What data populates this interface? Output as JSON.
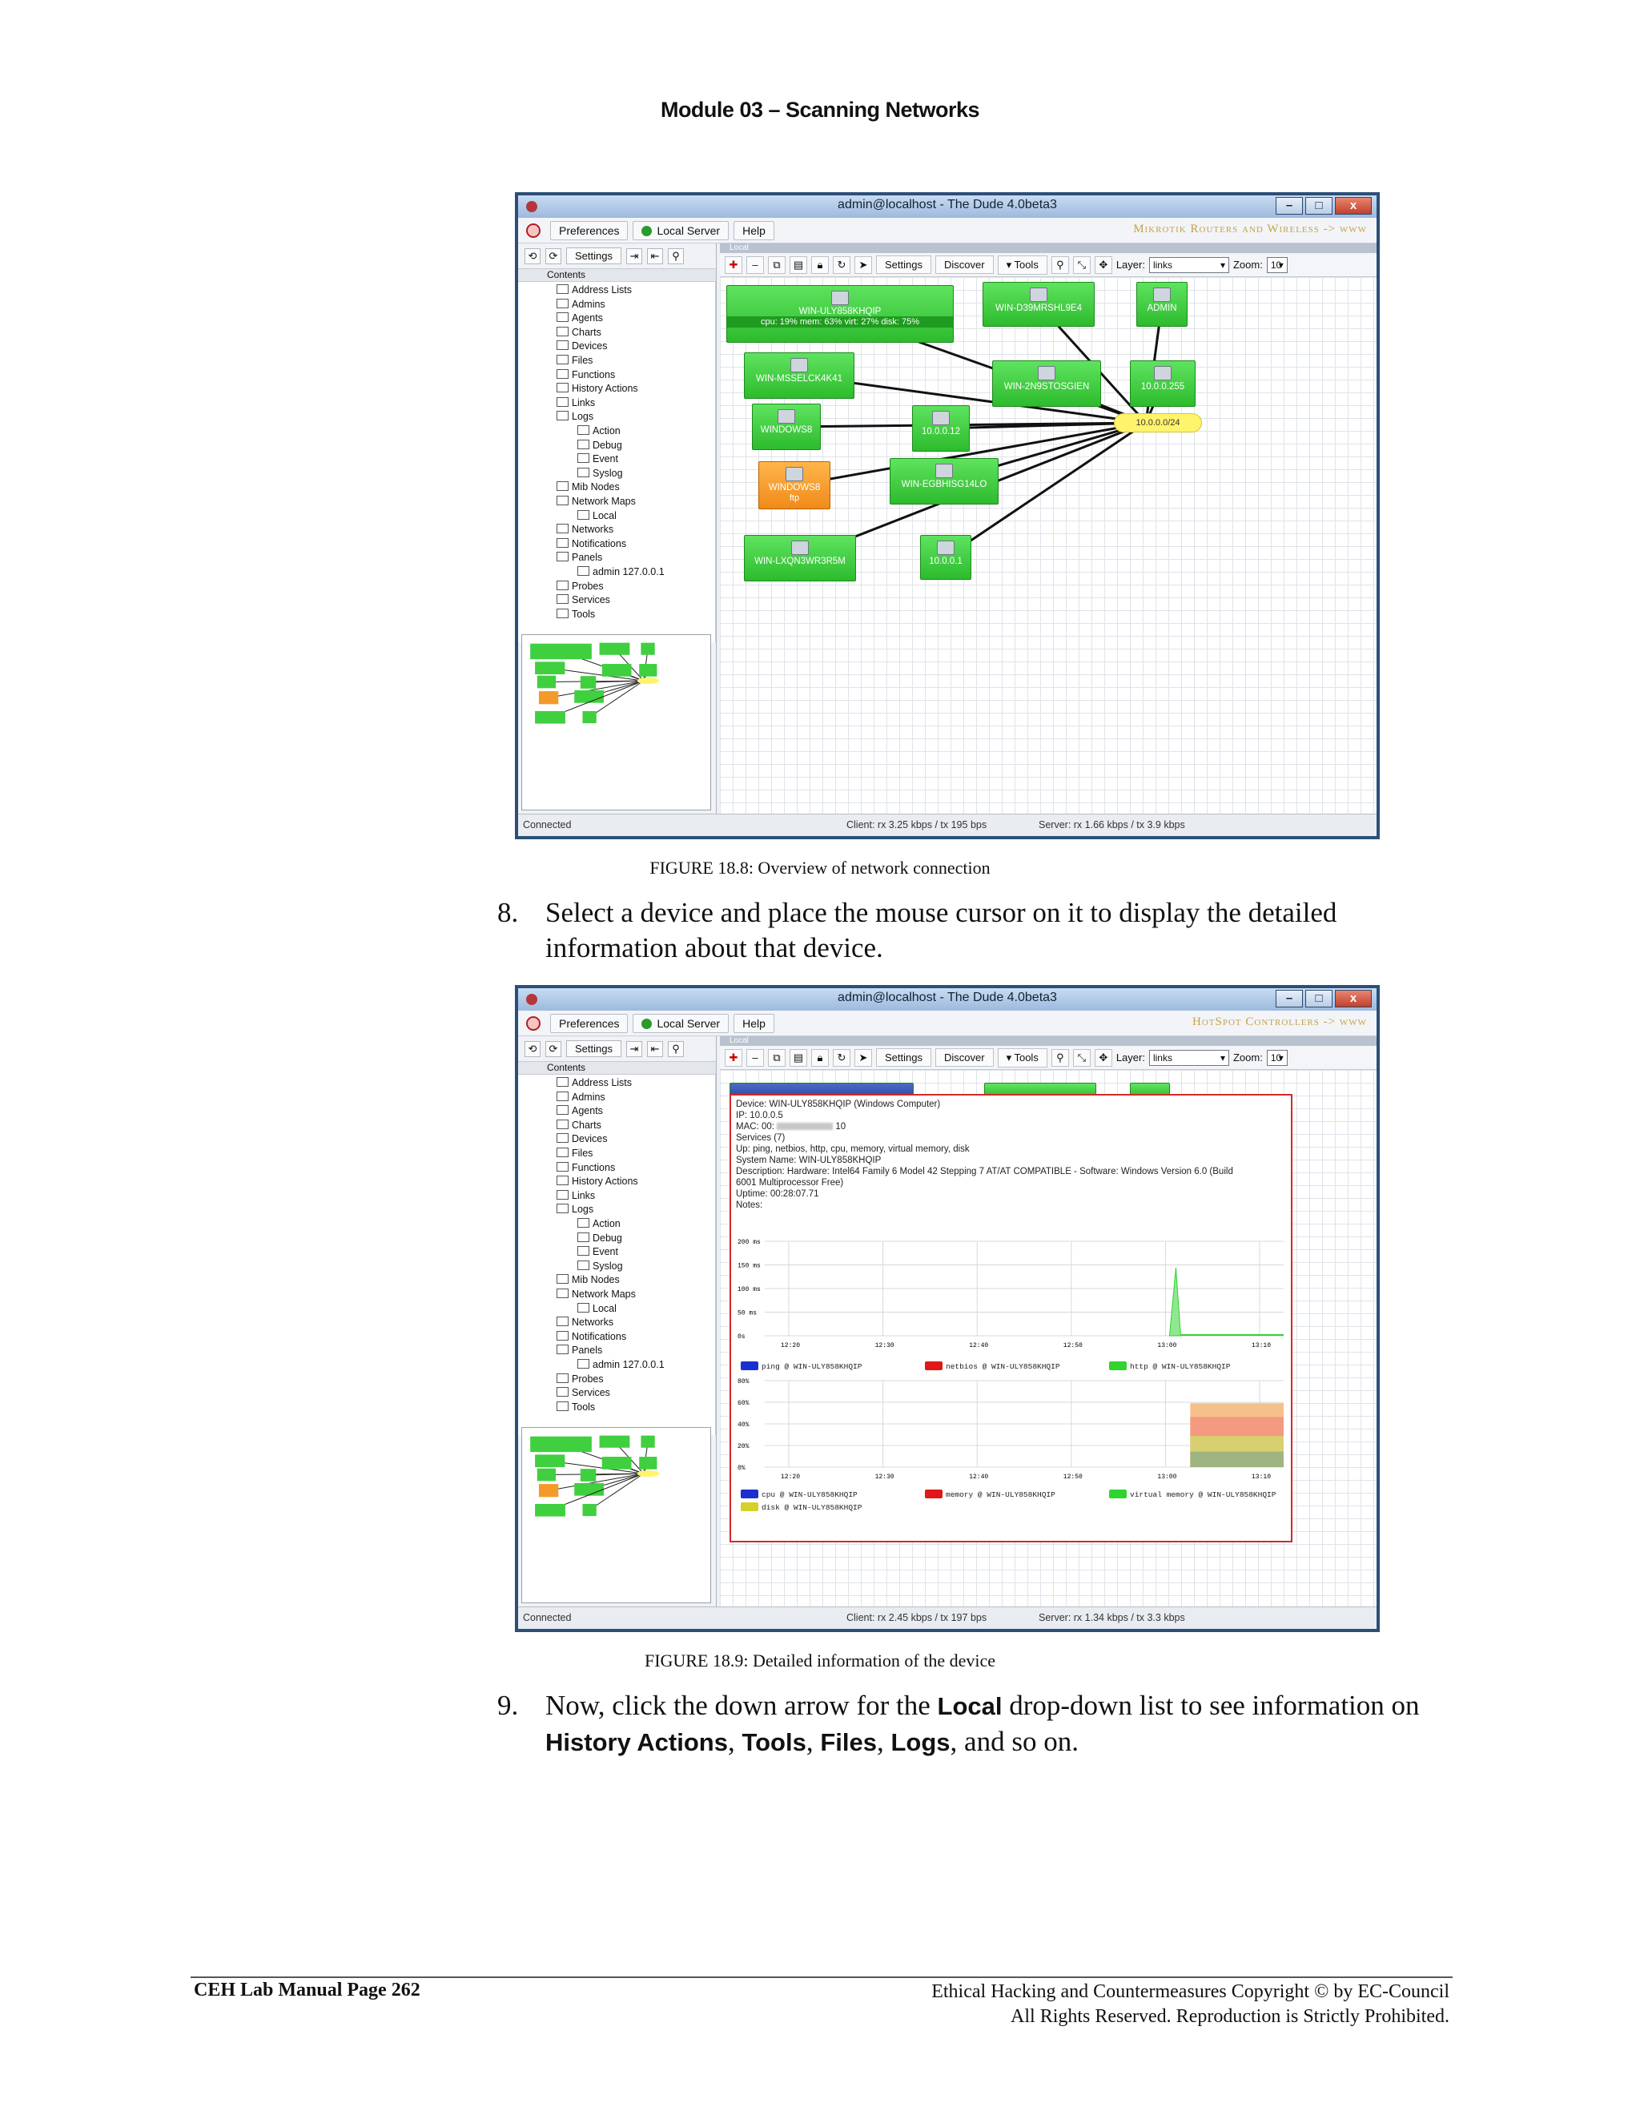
{
  "header": {
    "module_title": "Module 03 – Scanning Networks"
  },
  "window": {
    "title": "admin@localhost - The Dude 4.0beta3",
    "menu": [
      "Preferences",
      "Local Server",
      "Help"
    ],
    "brand_1": "Mikrotik Routers and Wireless -> www",
    "brand_2": "HotSpot Controllers -> www",
    "settings_label": "Settings",
    "contents_label": "Contents",
    "tab_label": "Local",
    "toolbar": {
      "settings": "Settings",
      "discover": "Discover",
      "tools": "▾ Tools",
      "layer_label": "Layer:",
      "layer_value": "links",
      "zoom_label": "Zoom:",
      "zoom_value": "10"
    },
    "tree": [
      {
        "label": "Address Lists",
        "indent": 1
      },
      {
        "label": "Admins",
        "indent": 1
      },
      {
        "label": "Agents",
        "indent": 1
      },
      {
        "label": "Charts",
        "indent": 1
      },
      {
        "label": "Devices",
        "indent": 1
      },
      {
        "label": "Files",
        "indent": 1
      },
      {
        "label": "Functions",
        "indent": 1
      },
      {
        "label": "History Actions",
        "indent": 1
      },
      {
        "label": "Links",
        "indent": 1
      },
      {
        "label": "Logs",
        "indent": 1
      },
      {
        "label": "Action",
        "indent": 2
      },
      {
        "label": "Debug",
        "indent": 2
      },
      {
        "label": "Event",
        "indent": 2
      },
      {
        "label": "Syslog",
        "indent": 2
      },
      {
        "label": "Mib Nodes",
        "indent": 1
      },
      {
        "label": "Network Maps",
        "indent": 1
      },
      {
        "label": "Local",
        "indent": 2
      },
      {
        "label": "Networks",
        "indent": 1
      },
      {
        "label": "Notifications",
        "indent": 1
      },
      {
        "label": "Panels",
        "indent": 1
      },
      {
        "label": "admin 127.0.0.1",
        "indent": 2
      },
      {
        "label": "Probes",
        "indent": 1
      },
      {
        "label": "Services",
        "indent": 1
      },
      {
        "label": "Tools",
        "indent": 1
      }
    ],
    "status_1": {
      "left": "Connected",
      "client": "Client: rx 3.25 kbps / tx 195 bps",
      "server": "Server: rx 1.66 kbps / tx 3.9 kbps"
    },
    "status_2": {
      "left": "Connected",
      "client": "Client: rx 2.45 kbps / tx 197 bps",
      "server": "Server: rx 1.34 kbps / tx 3.3 kbps"
    }
  },
  "map": {
    "nodes": [
      {
        "label": "WIN-ULY858KHQIP",
        "sub": "cpu: 19% mem: 63% virt: 27% disk: 75%",
        "color": "green"
      },
      {
        "label": "WIN-D39MRSHL9E4",
        "color": "green"
      },
      {
        "label": "ADMIN",
        "color": "green"
      },
      {
        "label": "WIN-MSSELCK4K41",
        "color": "green"
      },
      {
        "label": "WIN-2N9STOSGIEN",
        "color": "green"
      },
      {
        "label": "10.0.0.255",
        "color": "green"
      },
      {
        "label": "WINDOWS8",
        "color": "green"
      },
      {
        "label": "10.0.0.12",
        "color": "green"
      },
      {
        "label": "WINDOWS8",
        "sub": "ftp",
        "color": "orange"
      },
      {
        "label": "WIN-EGBHISG14LO",
        "color": "green"
      },
      {
        "label": "WIN-LXQN3WR3R5M",
        "color": "green"
      },
      {
        "label": "10.0.0.1",
        "color": "green"
      }
    ],
    "cloud": "10.0.0.0/24"
  },
  "figure1_caption": "FIGURE 18.8: Overview of network connection",
  "step8": {
    "num": "8.",
    "text": "Select a device and place the mouse cursor on it to display the detailed information about that device."
  },
  "popup": {
    "lines": [
      "Device: WIN-ULY858KHQIP (Windows Computer)",
      "IP: 10.0.0.5",
      "MAC: 00:",
      "Services (7)",
      "Up: ping, netbios, http, cpu, memory, virtual memory, disk",
      "System Name: WIN-ULY858KHQIP",
      "Description: Hardware: Intel64 Family 6 Model 42 Stepping 7 AT/AT COMPATIBLE - Software: Windows Version 6.0 (Build",
      "6001 Multiprocessor Free)",
      "Uptime: 00:28:07.71",
      "Notes:"
    ],
    "mac_suffix": "10",
    "graph1": {
      "y_ticks": [
        "200 ms",
        "150 ms",
        "100 ms",
        "50 ms",
        "0s"
      ],
      "x_ticks": [
        "12:20",
        "12:30",
        "12:40",
        "12:50",
        "13:00",
        "13:10"
      ],
      "legend": [
        {
          "label": "ping @ WIN-ULY858KHQIP",
          "color": "#1a2fd0"
        },
        {
          "label": "netbios @ WIN-ULY858KHQIP",
          "color": "#e01818"
        },
        {
          "label": "http @ WIN-ULY858KHQIP",
          "color": "#2fd42f"
        }
      ]
    },
    "graph2": {
      "y_ticks": [
        "80%",
        "60%",
        "40%",
        "20%",
        "0%"
      ],
      "x_ticks": [
        "12:20",
        "12:30",
        "12:40",
        "12:50",
        "13:00",
        "13:10"
      ],
      "legend": [
        {
          "label": "cpu @ WIN-ULY858KHQIP",
          "color": "#1a2fd0"
        },
        {
          "label": "memory @ WIN-ULY858KHQIP",
          "color": "#e01818"
        },
        {
          "label": "virtual memory @ WIN-ULY858KHQIP",
          "color": "#2fd42f"
        },
        {
          "label": "disk @ WIN-ULY858KHQIP",
          "color": "#d6d02a"
        }
      ]
    }
  },
  "figure2_caption": "FIGURE 18.9: Detailed information of the device",
  "step9": {
    "num": "9.",
    "pre": "Now, click the down arrow for the ",
    "b1": "Local",
    "mid1": " drop-down list to see information on ",
    "b2": "History Actions",
    "c1": ", ",
    "b3": "Tools",
    "c2": ", ",
    "b4": "Files",
    "c3": ", ",
    "b5": "Logs",
    "post": ", and so on."
  },
  "footer": {
    "left": "CEH Lab Manual Page 262",
    "right_1": "Ethical Hacking and Countermeasures Copyright © by EC-Council",
    "right_2": "All Rights Reserved. Reproduction is Strictly Prohibited."
  }
}
